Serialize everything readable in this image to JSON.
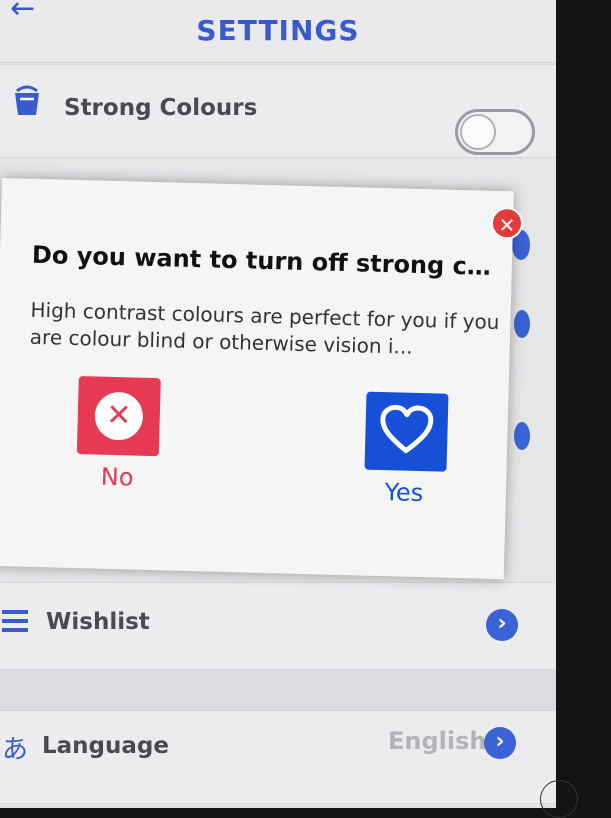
{
  "header": {
    "back_icon": "arrow-left-icon",
    "title": "SETTINGS"
  },
  "rows": {
    "strong_colours": {
      "icon": "paint-bucket-icon",
      "label": "Strong Colours",
      "toggle_on": false
    },
    "wishlist": {
      "icon": "list-icon",
      "label": "Wishlist"
    },
    "language": {
      "icon": "hiragana-icon",
      "icon_glyph": "あ",
      "label": "Language",
      "value": "English"
    }
  },
  "dialog": {
    "close_icon": "close-icon",
    "title": "Do you want to turn off strong co...",
    "body": "High contrast colours are perfect for you if you are colour blind or otherwise vision i...",
    "no_label": "No",
    "yes_label": "Yes"
  },
  "colors": {
    "accent_blue": "#3a5bd0",
    "no_red": "#e63a55",
    "yes_blue": "#1550d6"
  }
}
